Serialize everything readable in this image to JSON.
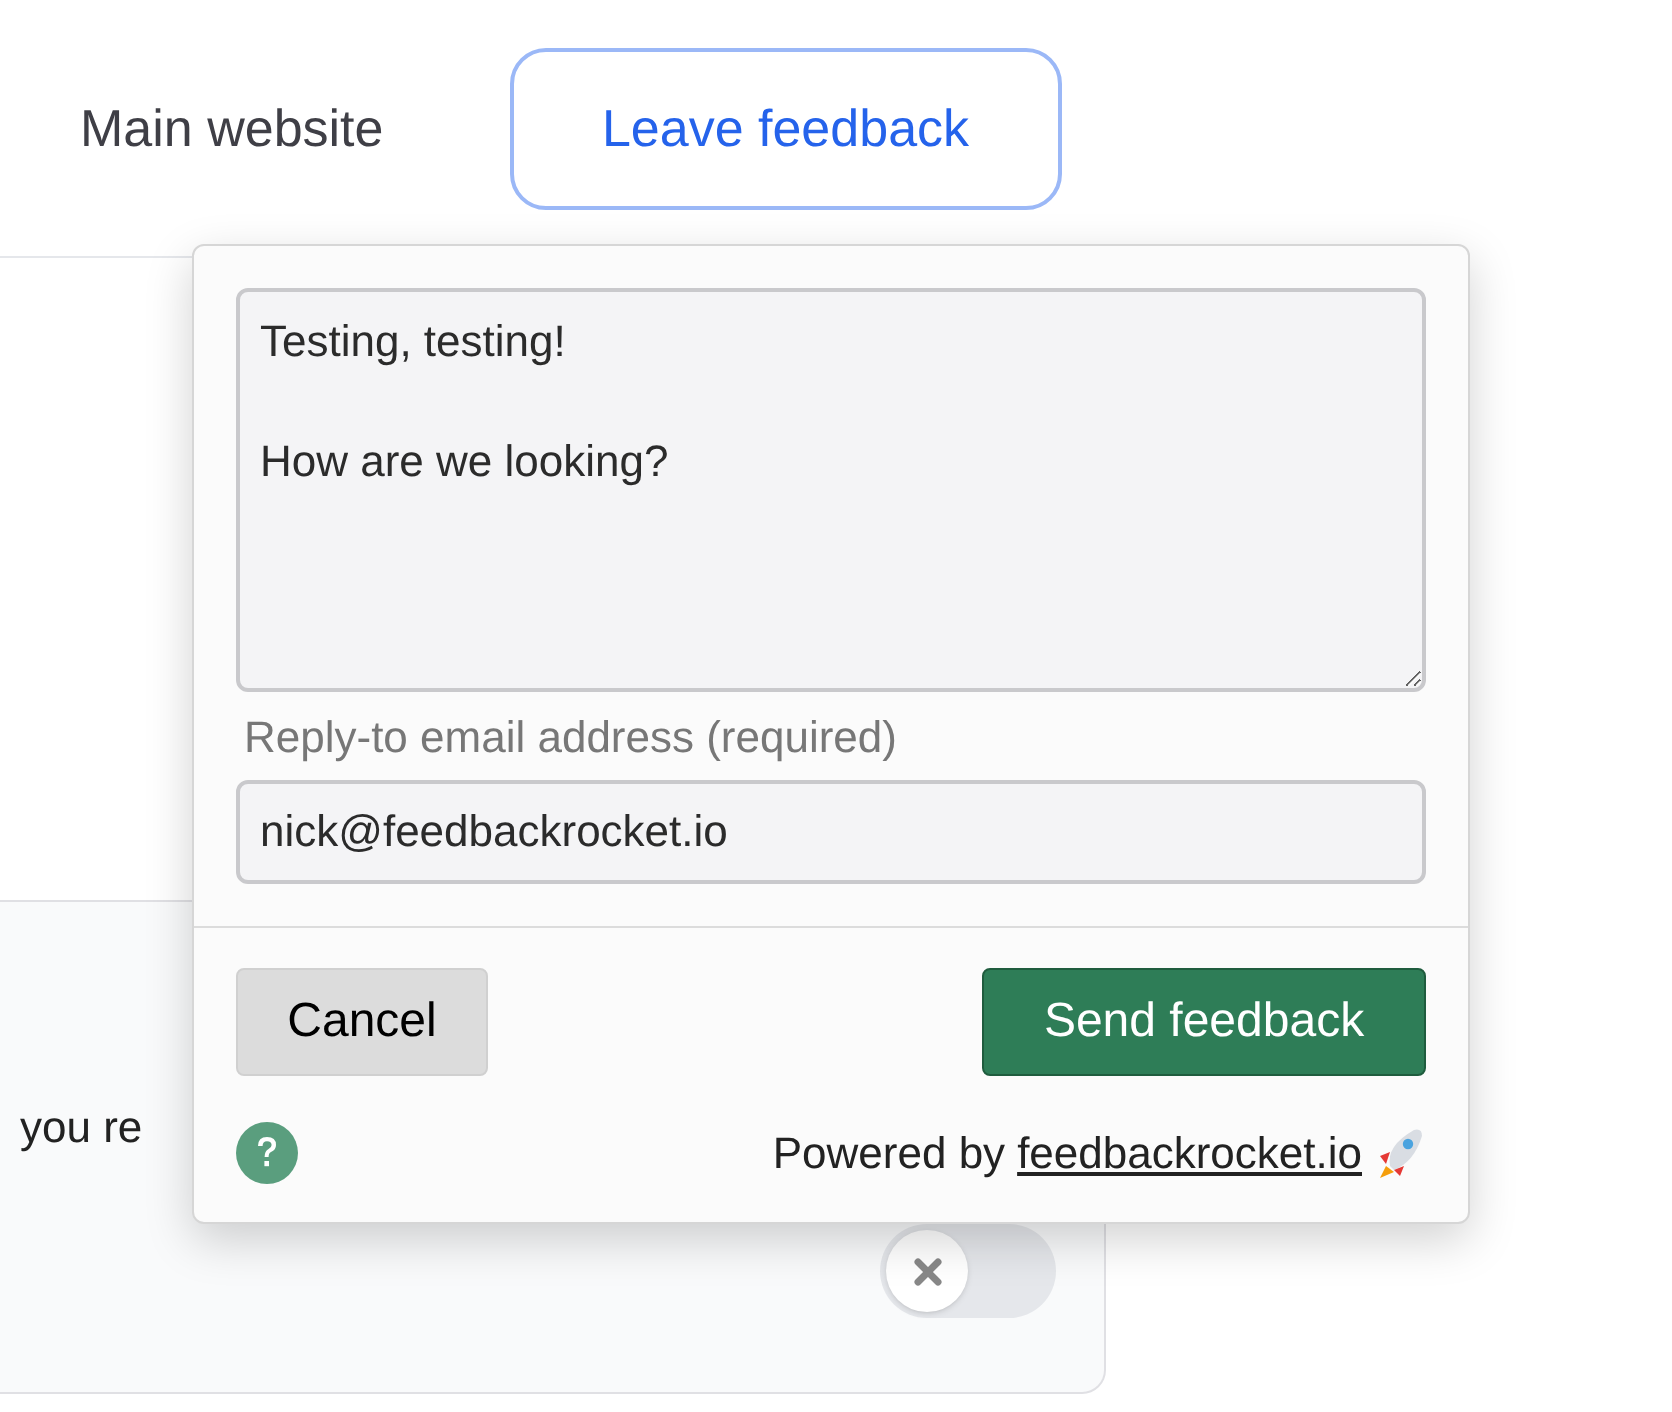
{
  "nav": {
    "link": "Main website",
    "button": "Leave feedback"
  },
  "card": {
    "text": "you re",
    "toggle": {
      "on": false
    }
  },
  "feedback_popup": {
    "message": "Testing, testing!\n\nHow are we looking?",
    "email_label": "Reply-to email address (required)",
    "email": "nick@feedbackrocket.io",
    "buttons": [
      {
        "label": "Cancel",
        "kind": "secondary"
      },
      {
        "label": "Send feedback",
        "kind": "primary"
      }
    ],
    "powered_by": "Powered by",
    "link": "feedbackrocket.io"
  }
}
